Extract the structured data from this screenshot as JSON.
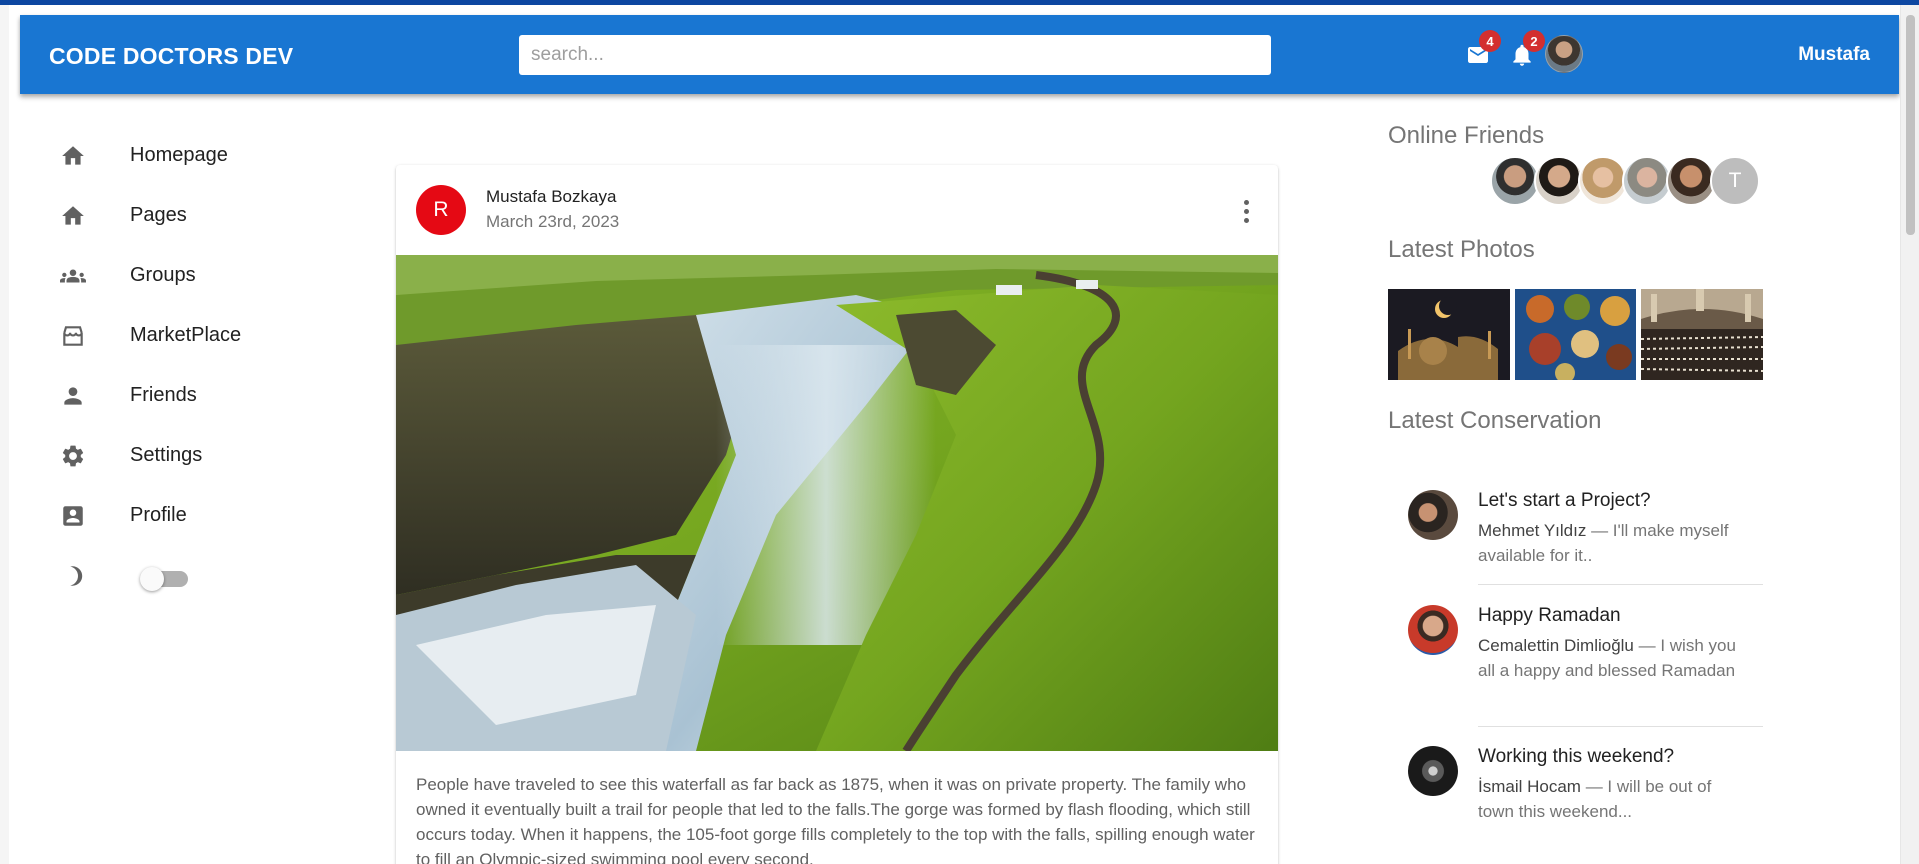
{
  "appbar": {
    "brand": "CODE DOCTORS DEV",
    "search_placeholder": "search...",
    "mail_count": "4",
    "notification_count": "2",
    "username": "Mustafa"
  },
  "sidebar": {
    "items": [
      {
        "label": "Homepage",
        "icon": "home-icon"
      },
      {
        "label": "Pages",
        "icon": "home-icon"
      },
      {
        "label": "Groups",
        "icon": "groups-icon"
      },
      {
        "label": "MarketPlace",
        "icon": "storefront-icon"
      },
      {
        "label": "Friends",
        "icon": "person-icon"
      },
      {
        "label": "Settings",
        "icon": "gear-icon"
      },
      {
        "label": "Profile",
        "icon": "account-box-icon"
      }
    ],
    "dark_mode_enabled": false
  },
  "post": {
    "avatar_letter": "R",
    "author": "Mustafa Bozkaya",
    "date": "March 23rd, 2023",
    "text": "People have traveled to see this waterfall as far back as 1875, when it was on private property. The family who owned it eventually built a trail for people that led to the falls.The gorge was formed by flash flooding, which still occurs today. When it happens, the 105-foot gorge fills completely to the top with the falls, spilling enough water to fill an Olympic-sized swimming pool every second."
  },
  "right": {
    "online_friends_title": "Online Friends",
    "online_friends_last_letter": "T",
    "latest_photos_title": "Latest Photos",
    "latest_conversation_title": "Latest Conservation",
    "conversations": [
      {
        "title": "Let's start a Project?",
        "who": "Mehmet Yıldız",
        "message": " — I'll make myself available for it.."
      },
      {
        "title": "Happy Ramadan",
        "who": "Cemalettin Dimlioğlu",
        "message": " — I wish you all a happy and blessed Ramadan"
      },
      {
        "title": "Working this weekend?",
        "who": "İsmail Hocam",
        "message": " — I will be out of town this weekend..."
      }
    ]
  },
  "colors": {
    "appbar": "#1976d2",
    "badge": "#d32f2f",
    "post_avatar": "#e50914"
  }
}
